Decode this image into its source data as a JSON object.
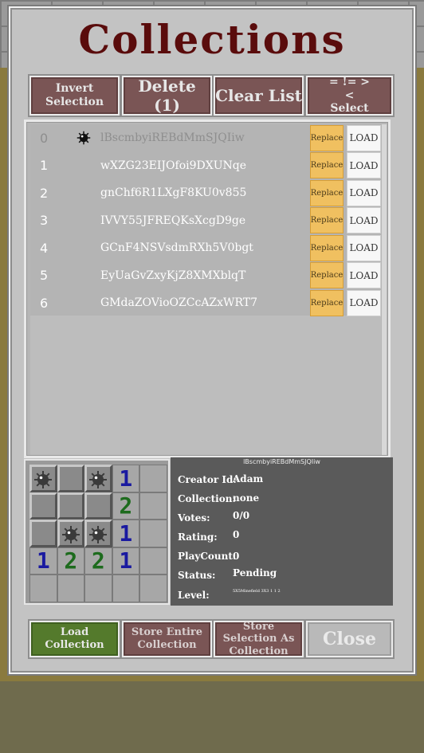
{
  "title": "Collections",
  "top_buttons": {
    "invert": "Invert Selection",
    "delete": "Delete (1)",
    "clear": "Clear List",
    "select": "= != > < Select"
  },
  "list": {
    "replace_label": "Replace",
    "load_label": "LOAD",
    "rows": [
      {
        "num": "0",
        "name": "lBscmbyiREBdMmSJQIiw",
        "selected": true
      },
      {
        "num": "1",
        "name": "wXZG23EIJOfoi9DXUNqe",
        "selected": false
      },
      {
        "num": "2",
        "name": "gnChf6R1LXgF8KU0v855",
        "selected": false
      },
      {
        "num": "3",
        "name": "IVVY55JFREQKsXcgD9ge",
        "selected": false
      },
      {
        "num": "4",
        "name": "GCnF4NSVsdmRXh5V0bgt",
        "selected": false
      },
      {
        "num": "5",
        "name": "EyUaGvZxyKjZ8XMXblqT",
        "selected": false
      },
      {
        "num": "6",
        "name": "GMdaZOVioOZCcAZxWRT7",
        "selected": false
      }
    ]
  },
  "preview": {
    "grid": [
      [
        "mine-covered",
        "covered",
        "mine-covered",
        "1",
        "open"
      ],
      [
        "covered",
        "covered",
        "covered",
        "2",
        "open"
      ],
      [
        "covered",
        "mine-covered",
        "mine-covered",
        "1",
        "open"
      ],
      [
        "1",
        "2",
        "2",
        "1",
        "open"
      ],
      [
        "open",
        "open",
        "open",
        "open",
        "open"
      ]
    ]
  },
  "info": {
    "header": "lBscmbyiREBdMmSJQIiw",
    "creator_label": "Creator Id:",
    "creator_value": "Adam",
    "collection_label": "Collection:",
    "collection_value": "none",
    "votes_label": "Votes:",
    "votes_value": "0/0",
    "rating_label": "Rating:",
    "rating_value": "0",
    "playcount_label": "PlayCount:",
    "playcount_value": "0",
    "status_label": "Status:",
    "status_value": "Pending",
    "level_label": "Level:",
    "level_value": "5X5Minefield 3X3 1 1 2"
  },
  "bottom_buttons": {
    "load": "Load Collection",
    "store_entire": "Store Entire Collection",
    "store_selection": "Store Selection As Collection",
    "close": "Close"
  },
  "colors": {
    "title": "#5a0c0c",
    "button_red": "#7a5555",
    "button_green": "#547a2c",
    "replace": "#f0c060",
    "number_one": "#1a1aa0",
    "number_two": "#1d6b1d"
  }
}
